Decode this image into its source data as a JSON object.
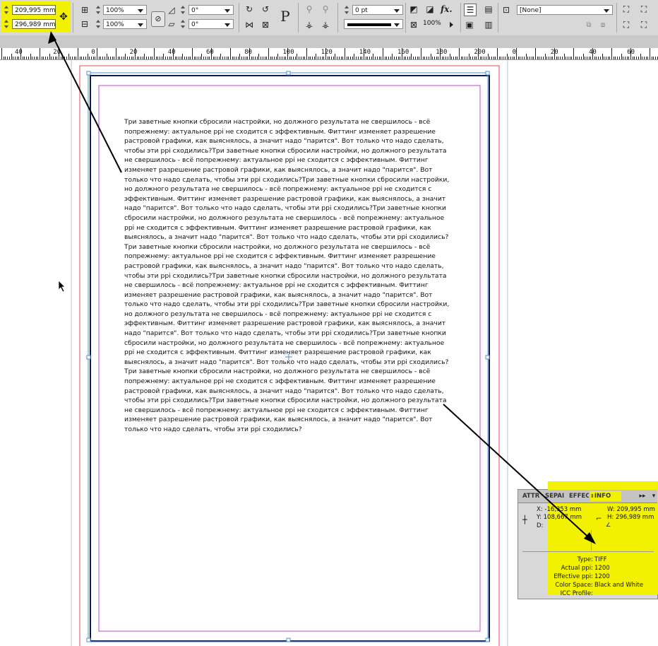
{
  "toolbar": {
    "width_value": "209,995 mm",
    "height_value": "296,989 mm",
    "scale_x": "100%",
    "scale_y": "100%",
    "rotate": "0°",
    "shear": "0°",
    "stroke_weight": "0 pt",
    "opacity": "100%",
    "object_style": "[None]",
    "text_frame_icon": "P",
    "effects_label": "fx.",
    "highlight_color": "#f2f200"
  },
  "ruler": {
    "labels": [
      "40",
      "20",
      "0",
      "20",
      "40",
      "60",
      "80",
      "100",
      "120",
      "140",
      "160",
      "180",
      "200",
      "0",
      "20",
      "40",
      "60",
      "80"
    ]
  },
  "document": {
    "body_text": "Три заветные кнопки сбросили настройки, но должного результата не свершилось - всё попрежнему: актуальное ppi не сходится с эффективным. Фиттинг изменяет разрешение растровой графики, как выяснялось, а значит надо \"парится\". Вот только что надо сделать, чтобы эти ppi сходились?Три заветные кнопки сбросили настройки, но должного результата не свершилось - всё попрежнему: актуальное ppi не сходится с эффективным. Фиттинг изменяет разрешение растровой графики, как выяснялось, а значит надо \"парится\". Вот только что надо сделать, чтобы эти ppi сходились?Три заветные кнопки сбросили настройки, но должного результата не свершилось - всё попрежнему: актуальное ppi не сходится с эффективным. Фиттинг изменяет разрешение растровой графики, как выяснялось, а значит надо \"парится\". Вот только что надо сделать, чтобы эти ppi сходились?Три заветные кнопки сбросили настройки, но должного результата не свершилось - всё попрежнему: актуальное ppi не сходится с эффективным. Фиттинг изменяет разрешение растровой графики, как выяснялось, а значит надо \"парится\". Вот только что надо сделать, чтобы эти ppi сходились?Три заветные кнопки сбросили настройки, но должного результата не свершилось - всё попрежнему: актуальное ppi не сходится с эффективным. Фиттинг изменяет разрешение растровой графики, как выяснялось, а значит надо \"парится\". Вот только что надо сделать, чтобы эти ppi сходились?Три заветные кнопки сбросили настройки, но должного результата не свершилось - всё попрежнему: актуальное ppi не сходится с эффективным. Фиттинг изменяет разрешение растровой графики, как выяснялось, а значит надо \"парится\". Вот только что надо сделать, чтобы эти ppi сходились?Три заветные кнопки сбросили настройки, но должного результата не свершилось - всё попрежнему: актуальное ppi не сходится с эффективным. Фиттинг изменяет разрешение растровой графики, как выяснялось, а значит надо \"парится\". Вот только что надо сделать, чтобы эти ppi сходились?Три заветные кнопки сбросили настройки, но должного результата не свершилось - всё попрежнему: актуальное ppi не сходится с эффективным. Фиттинг изменяет разрешение растровой графики, как выяснялось, а значит надо \"парится\". Вот только что надо сделать, чтобы эти ppi сходились?Три заветные кнопки сбросили настройки, но должного результата не свершилось - всё попрежнему: актуальное ppi не сходится с эффективным. Фиттинг изменяет разрешение растровой графики, как выяснялось, а значит надо \"парится\". Вот только что надо сделать, чтобы эти ppi сходились?Три заветные кнопки сбросили настройки, но должного результата не свершилось - всё попрежнему: актуальное ppi не сходится с эффективным. Фиттинг изменяет разрешение растровой графики, как выяснялось, а значит надо \"парится\". Вот только что надо сделать, чтобы эти ppi сходились?"
  },
  "info_panel": {
    "tabs": [
      "ATTR",
      "SEPAI",
      "EFFEC",
      "INFO"
    ],
    "active_tab": "INFO",
    "x": "X: -16,353 mm",
    "y": "Y: 108,667 mm",
    "d": "D:",
    "w": "W: 209,995 mm",
    "h": "H: 296,989 mm",
    "type_label": "Type:",
    "type_value": "TIFF",
    "actual_label": "Actual ppi:",
    "actual_value": "1200",
    "effective_label": "Effective ppi:",
    "effective_value": "1200",
    "colorspace_label": "Color Space:",
    "colorspace_value": "Black and White",
    "icc_label": "ICC Profile:",
    "icc_value": ""
  }
}
